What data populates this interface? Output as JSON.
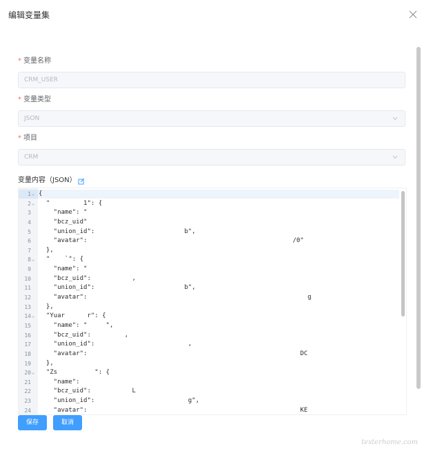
{
  "dialog": {
    "title": "编辑变量集"
  },
  "fields": [
    {
      "label": "变量名称",
      "value": "CRM_USER",
      "required": true,
      "select": false
    },
    {
      "label": "变量类型",
      "value": "JSON",
      "required": true,
      "select": true
    },
    {
      "label": "项目",
      "value": "CRM",
      "required": true,
      "select": true
    }
  ],
  "json_section": {
    "label": "变量内容（JSON）"
  },
  "editor": {
    "lines": [
      {
        "n": "1",
        "fold": true,
        "text": "{"
      },
      {
        "n": "2",
        "fold": true,
        "text": "  \"         1\": {"
      },
      {
        "n": "3",
        "fold": false,
        "text": "    \"name\": \""
      },
      {
        "n": "4",
        "fold": false,
        "text": "    \"bcz_uid\""
      },
      {
        "n": "5",
        "fold": false,
        "text": "    \"union_id\":                        b\","
      },
      {
        "n": "6",
        "fold": false,
        "text": "    \"avatar\":                                                       /0\""
      },
      {
        "n": "7",
        "fold": false,
        "text": "  },"
      },
      {
        "n": "8",
        "fold": true,
        "text": "  \"    `\": {"
      },
      {
        "n": "9",
        "fold": false,
        "text": "    \"name\": \""
      },
      {
        "n": "10",
        "fold": false,
        "text": "    \"bcz_uid\":           ,"
      },
      {
        "n": "11",
        "fold": false,
        "text": "    \"union_id\":                        b\","
      },
      {
        "n": "12",
        "fold": false,
        "text": "    \"avatar\":                                                           g"
      },
      {
        "n": "13",
        "fold": false,
        "text": "  },"
      },
      {
        "n": "14",
        "fold": true,
        "text": "  \"Yuar      r\": {"
      },
      {
        "n": "15",
        "fold": false,
        "text": "    \"name\": \"     \","
      },
      {
        "n": "16",
        "fold": false,
        "text": "    \"bcz_uid\":         ,"
      },
      {
        "n": "17",
        "fold": false,
        "text": "    \"union_id\":                         ,"
      },
      {
        "n": "18",
        "fold": false,
        "text": "    \"avatar\":                                                         DC"
      },
      {
        "n": "19",
        "fold": false,
        "text": "  },"
      },
      {
        "n": "20",
        "fold": true,
        "text": "  \"Zs          \": {"
      },
      {
        "n": "21",
        "fold": false,
        "text": "    \"name\":"
      },
      {
        "n": "22",
        "fold": false,
        "text": "    \"bcz_uid\":           L"
      },
      {
        "n": "23",
        "fold": false,
        "text": "    \"union_id\":                         g\","
      },
      {
        "n": "24",
        "fold": false,
        "text": "    \"avatar\":                                                         KE"
      }
    ]
  },
  "buttons": {
    "save": "保存",
    "cancel": "取消"
  },
  "watermark": "testerhome.com",
  "colors": {
    "primary": "#409eff",
    "required": "#f56c6c"
  },
  "icons": [
    "close-icon",
    "chevron-down-icon",
    "edit-icon",
    "fold-arrow-icon"
  ]
}
